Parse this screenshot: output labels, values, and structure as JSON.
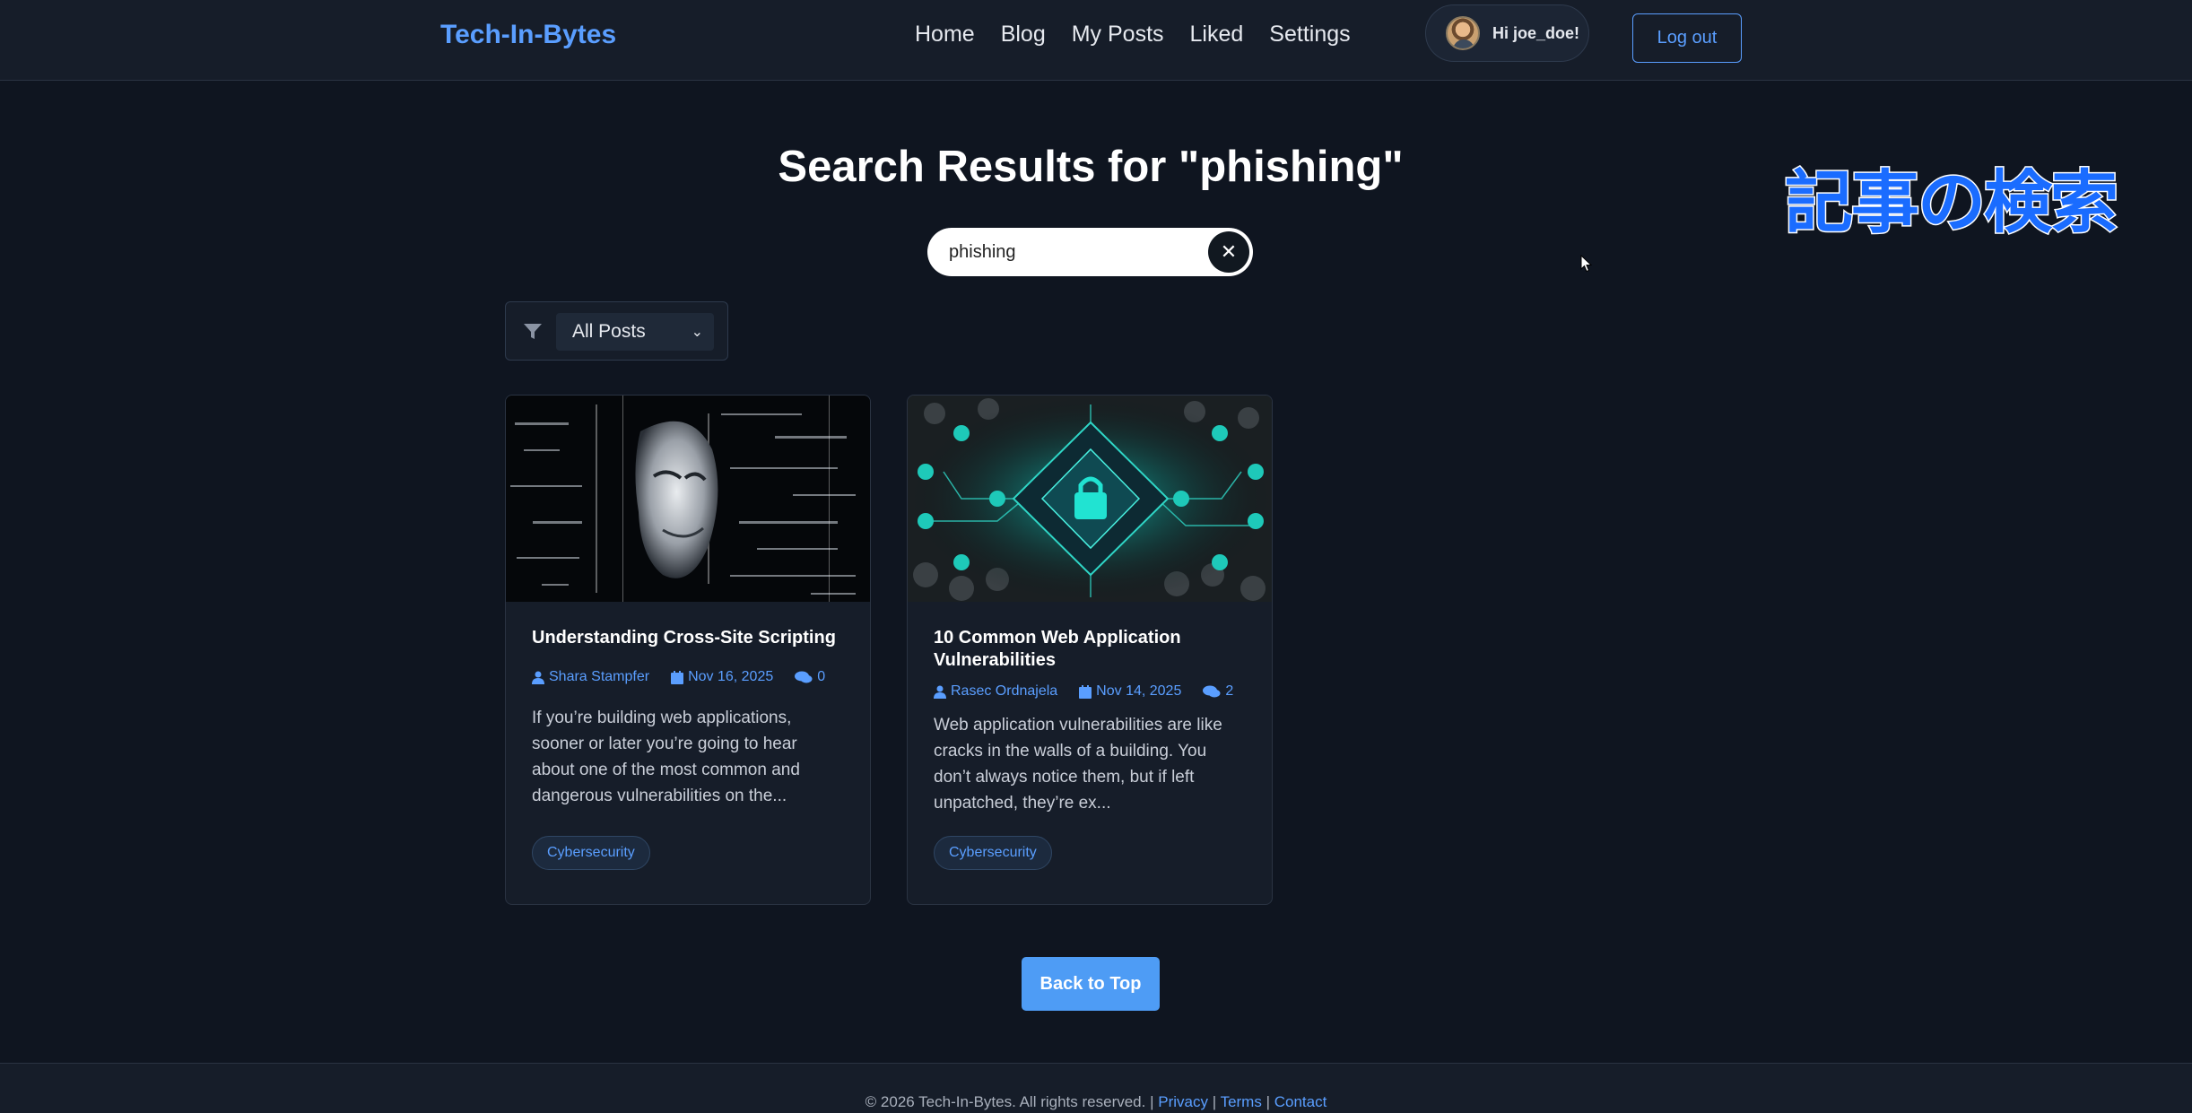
{
  "navbar": {
    "brand": "Tech-In-Bytes",
    "links": [
      "Home",
      "Blog",
      "My Posts",
      "Liked",
      "Settings"
    ],
    "greeting": "Hi joe_doe!",
    "logout_label": "Log out"
  },
  "search": {
    "title": "Search Results for \"phishing\"",
    "value": "phishing",
    "clear_icon": "close-icon"
  },
  "overlay_text": "記事の検索",
  "filter": {
    "selected": "All Posts",
    "icon": "filter-icon"
  },
  "posts": [
    {
      "title": "Understanding Cross-Site Scripting",
      "author": "Shara Stampfer",
      "date": "Nov 16, 2025",
      "comments": "0",
      "excerpt": "If you’re building web applications, sooner or later you’re going to hear about one of the most common and dangerous vulnerabilities on the...",
      "tag": "Cybersecurity"
    },
    {
      "title": "10 Common Web Application Vulnerabilities",
      "author": "Rasec Ordnajela",
      "date": "Nov 14, 2025",
      "comments": "2",
      "excerpt": "Web application vulnerabilities are like cracks in the walls of a building. You don’t always notice them, but if left unpatched, they’re ex...",
      "tag": "Cybersecurity"
    }
  ],
  "back_to_top_label": "Back to Top",
  "footer": {
    "copyright": "© 2026 Tech-In-Bytes. All rights reserved.",
    "links": [
      "Privacy",
      "Terms",
      "Contact"
    ]
  },
  "colors": {
    "accent": "#5a9eff",
    "background": "#0f1520",
    "surface": "#161d29"
  }
}
